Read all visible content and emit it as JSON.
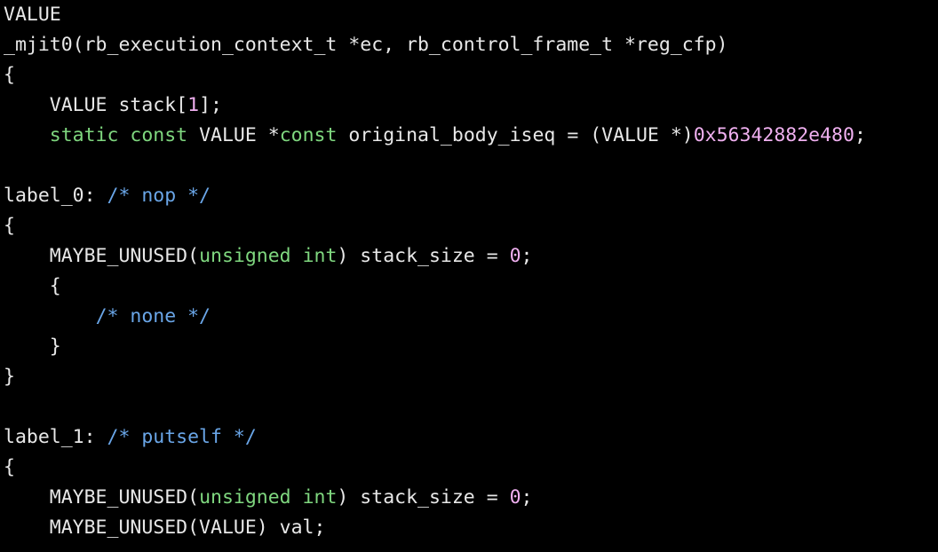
{
  "code": {
    "l1": {
      "t1": "VALUE"
    },
    "l2": {
      "t1": "_mjit0(rb_execution_context_t *ec, rb_control_frame_t *reg_cfp)"
    },
    "l3": {
      "t1": "{"
    },
    "l4": {
      "t1": "    VALUE stack[",
      "n1": "1",
      "t2": "];"
    },
    "l5": {
      "t1": "    ",
      "k1": "static",
      "t2": " ",
      "k2": "const",
      "t3": " VALUE *",
      "k3": "const",
      "t4": " original_body_iseq = (VALUE *)",
      "n1": "0x56342882e480",
      "t5": ";"
    },
    "l7": {
      "t1": "label_0: ",
      "c1": "/* nop */"
    },
    "l8": {
      "t1": "{"
    },
    "l9": {
      "t1": "    MAYBE_UNUSED(",
      "k1": "unsigned",
      "t2": " ",
      "k2": "int",
      "t3": ") stack_size = ",
      "n1": "0",
      "t4": ";"
    },
    "l10": {
      "t1": "    {"
    },
    "l11": {
      "t1": "        ",
      "c1": "/* none */"
    },
    "l12": {
      "t1": "    }"
    },
    "l13": {
      "t1": "}"
    },
    "l15": {
      "t1": "label_1: ",
      "c1": "/* putself */"
    },
    "l16": {
      "t1": "{"
    },
    "l17": {
      "t1": "    MAYBE_UNUSED(",
      "k1": "unsigned",
      "t2": " ",
      "k2": "int",
      "t3": ") stack_size = ",
      "n1": "0",
      "t4": ";"
    },
    "l18": {
      "t1": "    MAYBE_UNUSED(VALUE) val;"
    }
  }
}
